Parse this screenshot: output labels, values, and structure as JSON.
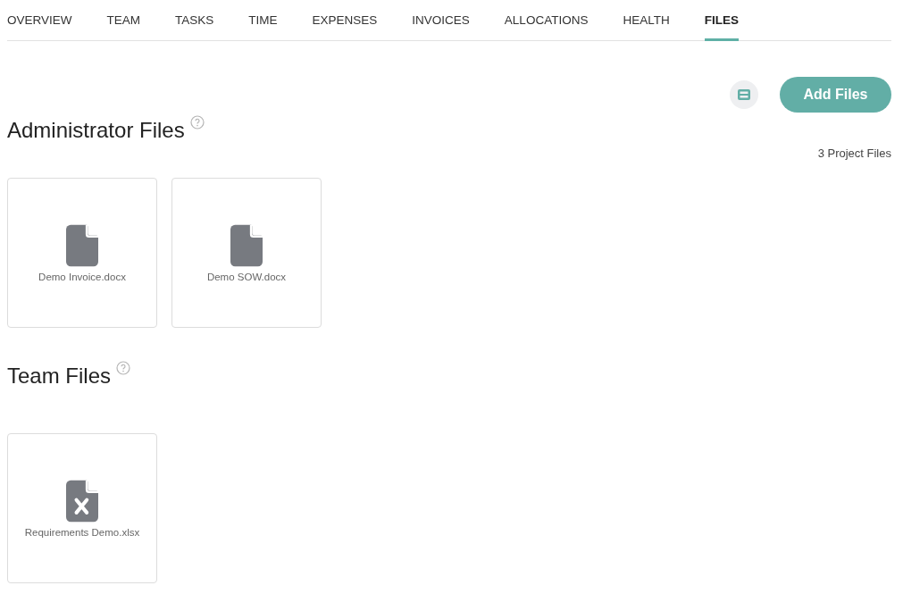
{
  "tabs": [
    {
      "label": "OVERVIEW",
      "selected": false
    },
    {
      "label": "TEAM",
      "selected": false
    },
    {
      "label": "TASKS",
      "selected": false
    },
    {
      "label": "TIME",
      "selected": false
    },
    {
      "label": "EXPENSES",
      "selected": false
    },
    {
      "label": "INVOICES",
      "selected": false
    },
    {
      "label": "ALLOCATIONS",
      "selected": false
    },
    {
      "label": "HEALTH",
      "selected": false
    },
    {
      "label": "FILES",
      "selected": true
    }
  ],
  "add_button": "Add Files",
  "file_count": "3 Project Files",
  "sections": [
    {
      "title": "Administrator Files",
      "files": [
        {
          "name": "Demo Invoice.docx",
          "kind": "document"
        },
        {
          "name": "Demo SOW.docx",
          "kind": "document"
        }
      ]
    },
    {
      "title": "Team Files",
      "files": [
        {
          "name": "Requirements Demo.xlsx",
          "kind": "spreadsheet"
        }
      ]
    }
  ]
}
